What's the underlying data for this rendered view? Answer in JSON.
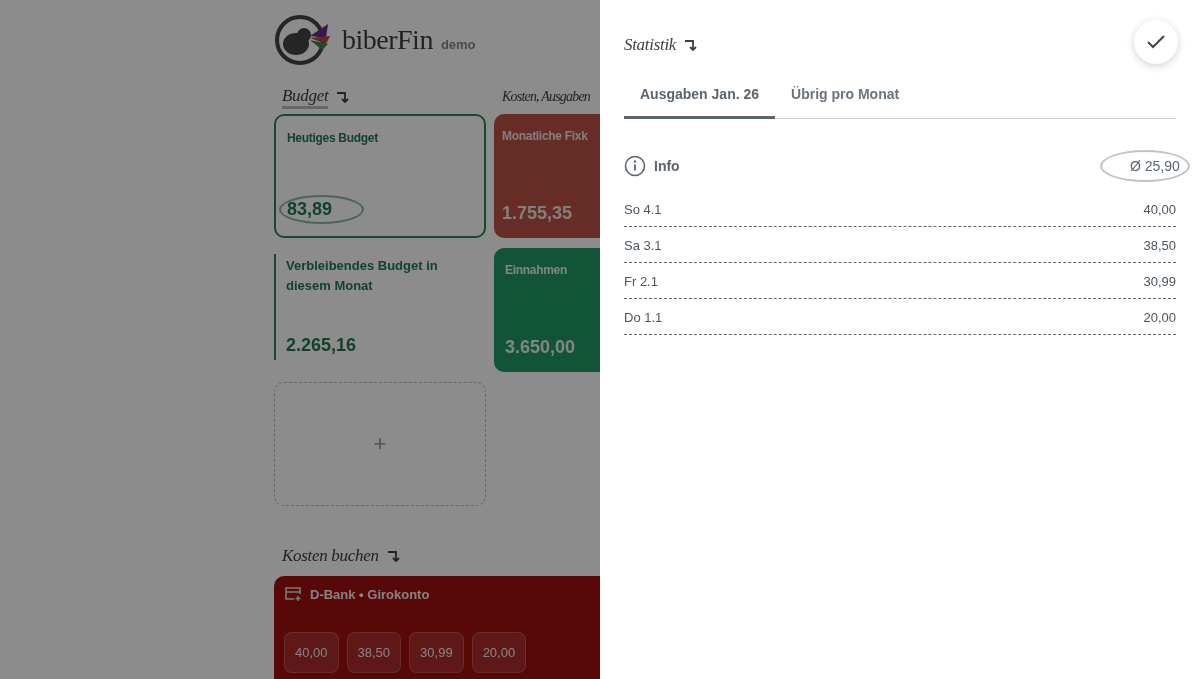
{
  "header": {
    "brand": "biberFin",
    "badge": "demo"
  },
  "sections": {
    "budget": "Budget",
    "costs": "Kosten, Ausgaben"
  },
  "cards": [
    {
      "kind": "outlined",
      "title": "Heutiges Budget",
      "amount": "83,89",
      "circled": true
    },
    {
      "kind": "expense",
      "title": "Monatliche Fixk",
      "amount": "1.755,35",
      "circled": false
    },
    {
      "kind": "bar",
      "title": "Verbleibendes Budget in diesem Monat",
      "amount": "2.265,16",
      "circled": false
    },
    {
      "kind": "income",
      "title": "Einnahmen",
      "amount": "3.650,00",
      "circled": false
    },
    {
      "kind": "add",
      "title": "+"
    }
  ],
  "booking": {
    "heading": "Kosten buchen",
    "account": "D-Bank • Girokonto",
    "amounts": [
      "40,00",
      "38,50",
      "30,99",
      "20,00"
    ]
  },
  "drawer": {
    "title": "Statistik",
    "tabs": [
      {
        "label": "Ausgaben Jan. 26",
        "selected": true
      },
      {
        "label": "Übrig pro Monat",
        "selected": false
      }
    ],
    "info": "Info",
    "average": "Ø 25,90",
    "rows": [
      {
        "day": "So 4.1",
        "amount": "40,00"
      },
      {
        "day": "Sa 3.1",
        "amount": "38,50"
      },
      {
        "day": "Fr 2.1",
        "amount": "30,99"
      },
      {
        "day": "Do 1.1",
        "amount": "20,00"
      }
    ]
  }
}
